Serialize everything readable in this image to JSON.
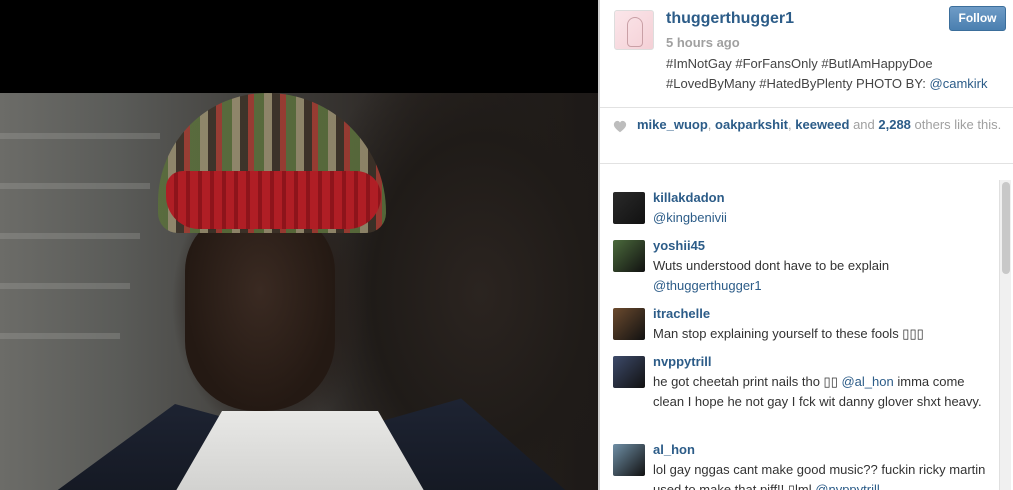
{
  "post": {
    "username": "thuggerthugger1",
    "time": "5 hours ago",
    "follow_label": "Follow",
    "caption_text": "#ImNotGay #ForFansOnly #ButIAmHappyDoe #LovedByMany #HatedByPlenty PHOTO BY: ",
    "caption_mention": "@camkirk"
  },
  "likes": {
    "user1": "mike_wuop",
    "sep1": ", ",
    "user2": "oakparkshit",
    "sep2": ", ",
    "user3": "keeweed",
    "and_text": " and ",
    "count": "2,288",
    "tail": " others like this."
  },
  "comments": [
    {
      "user": "killakdadon",
      "text": "",
      "mention": "@kingbenivii",
      "avatar_color": "#2a2a2a"
    },
    {
      "user": "yoshii45",
      "text": "Wuts understood dont have to be explain ",
      "mention": "@thuggerthugger1",
      "avatar_color": "#4b6a3c"
    },
    {
      "user": "itrachelle",
      "text": "Man stop explaining yourself to these fools ▯▯▯",
      "mention": "",
      "avatar_color": "#6b4a2e"
    },
    {
      "user": "nvppytrill",
      "text": "he got cheetah print nails tho ▯▯ ",
      "mention": "@al_hon",
      "text2": " imma come clean I hope he not gay I fck wit danny glover shxt heavy.",
      "avatar_color": "#3d4a6a"
    },
    {
      "user": "al_hon",
      "text": "lol gay nggas cant make good music?? fuckin ricky martin used to make that piff!! ▯lml ",
      "mention": "@nvppytrill",
      "avatar_color": "#6f8fa6"
    }
  ],
  "colors": {
    "link": "#2c5c88",
    "follow_bg": "#4a7fb0"
  },
  "icons": [
    "heart-icon"
  ]
}
